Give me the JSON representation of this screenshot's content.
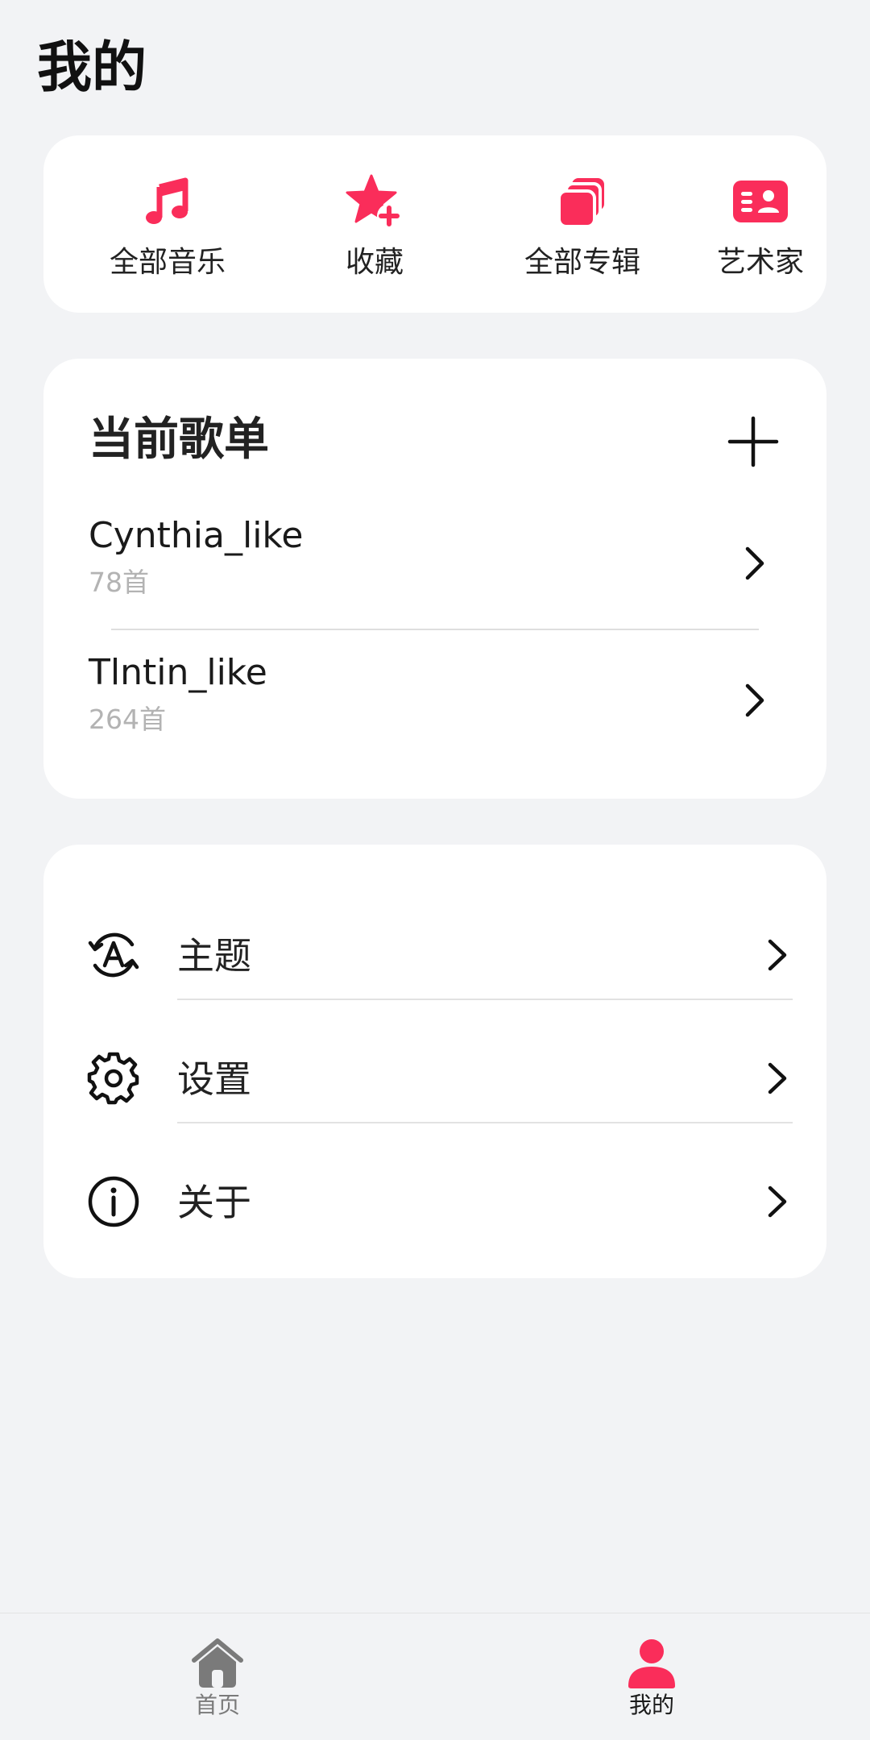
{
  "page": {
    "title": "我的"
  },
  "shortcuts": [
    {
      "label": "全部音乐",
      "icon": "music-note-icon"
    },
    {
      "label": "收藏",
      "icon": "star-plus-icon"
    },
    {
      "label": "全部专辑",
      "icon": "albums-stack-icon"
    },
    {
      "label": "艺术家",
      "icon": "artist-card-icon"
    }
  ],
  "playlists": {
    "title": "当前歌单",
    "add_icon": "plus-icon",
    "items": [
      {
        "name": "Cynthia_like",
        "count": "78首"
      },
      {
        "name": "Tlntin_like",
        "count": "264首"
      }
    ]
  },
  "settings": {
    "items": [
      {
        "label": "主题",
        "icon": "theme-icon"
      },
      {
        "label": "设置",
        "icon": "gear-icon"
      },
      {
        "label": "关于",
        "icon": "info-icon"
      }
    ]
  },
  "bottom_nav": {
    "items": [
      {
        "label": "首页",
        "icon": "home-icon",
        "active": false
      },
      {
        "label": "我的",
        "icon": "person-icon",
        "active": true
      }
    ]
  },
  "colors": {
    "accent": "#fa2d5a",
    "background": "#f2f3f5",
    "card": "#ffffff",
    "inactive_nav": "#7a7a7a"
  }
}
